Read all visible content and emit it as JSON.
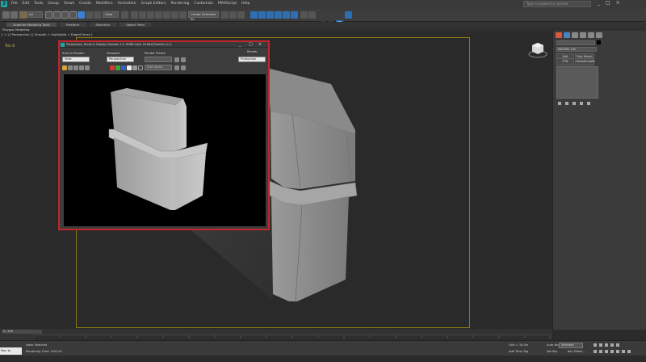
{
  "app": {
    "logo_letter": "3"
  },
  "menu": [
    "File",
    "Edit",
    "Tools",
    "Group",
    "Views",
    "Create",
    "Modifiers",
    "Animation",
    "Graph Editors",
    "Rendering",
    "Customize",
    "MAXScript",
    "Help"
  ],
  "search": {
    "placeholder": "Type a keyword or phrase"
  },
  "window_controls": {
    "minimize": "_",
    "maximize": "□",
    "close": "×"
  },
  "toolbar": {
    "selection_filter": "All",
    "view_dropdown": "View",
    "named_selection": "Create Selection Se",
    "axis_x": "X",
    "axis_y": "Y",
    "axis_z": "Z"
  },
  "ribbon": {
    "tabs": [
      "Graphite Modeling Tools",
      "Freeform",
      "Selection",
      "Object Paint"
    ],
    "sub_label": "Polygon Modeling"
  },
  "viewport": {
    "label": "[ + ] [ Perspective ] [ Smooth + Highlights + Edged Faces ]",
    "stats": "Tris:  0"
  },
  "command_panel": {
    "modifier_list": "Modifier List",
    "buttons": [
      {
        "label": "Edit"
      },
      {
        "label": "Poly Select"
      },
      {
        "label": "FFD"
      },
      {
        "label": "TurboSmooth"
      }
    ],
    "stack_icons": [
      "pin",
      "show-end",
      "unique",
      "remove",
      "config"
    ]
  },
  "render_window": {
    "title": "Perspective, frame 0, Display Gamma: 2.2, RGBA Color 16 Bits/Channel (1:1)",
    "area_to_render_label": "Area to Render:",
    "area_to_render_value": "View",
    "viewport_label": "Viewport:",
    "viewport_value": "Perspective",
    "render_preset_label": "Render Preset:",
    "render_preset_value": "",
    "render_label": "Render",
    "render_value": "Production",
    "channel_value": "RGB Alpha"
  },
  "timeline": {
    "slider": "0 / 100"
  },
  "status": {
    "maxscript": "Max to Physics",
    "none_selected": "None Selected",
    "rendering_time": "Rendering Time: 0:00:10",
    "grid": "Grid = 10.0m",
    "add_time_tag": "Add Time Tag",
    "auto_key": "Auto Key",
    "selected": "Selected",
    "set_key": "Set Key",
    "key_filters": "Key Filters..."
  }
}
